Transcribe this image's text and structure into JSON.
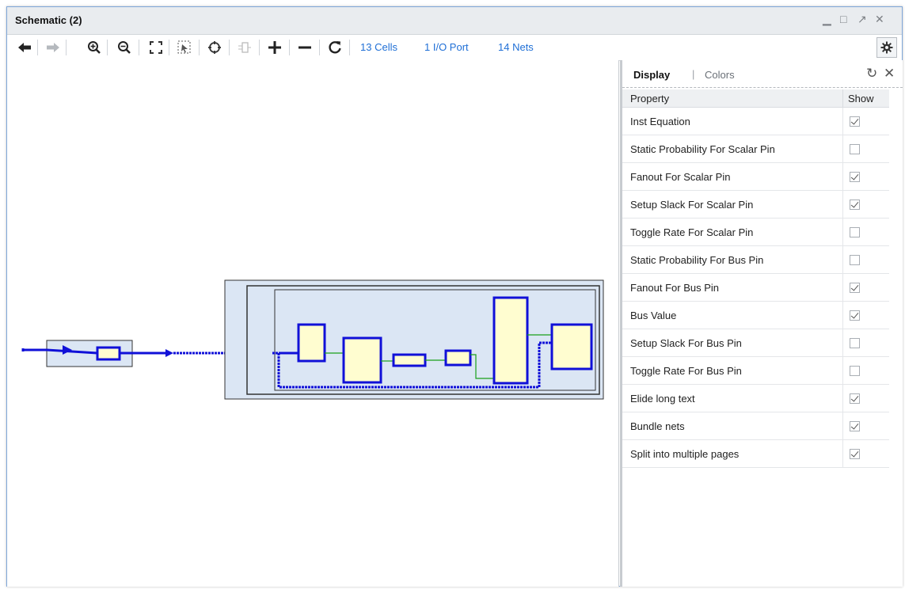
{
  "window": {
    "title": "Schematic (2)",
    "controls": [
      "minimize-icon",
      "maximize-icon",
      "restore-icon",
      "close-icon"
    ]
  },
  "toolbar": {
    "icons": [
      "back-arrow-icon",
      "forward-arrow-icon",
      "zoom-in-icon",
      "zoom-out-icon",
      "fit-view-icon",
      "zoom-select-icon",
      "find-crosshair-icon",
      "pin-icon",
      "expand-plus-icon",
      "collapse-minus-icon",
      "refresh-icon"
    ],
    "cells": "13 Cells",
    "ports": "1 I/O Port",
    "nets": "14 Nets",
    "settings_icon": "gear-icon"
  },
  "panel": {
    "tabs": {
      "display": "Display",
      "separator": "|",
      "colors": "Colors"
    },
    "columns": {
      "property": "Property",
      "show": "Show"
    },
    "rows": [
      {
        "label": "Inst Equation",
        "checked": true
      },
      {
        "label": "Static Probability For Scalar Pin",
        "checked": false
      },
      {
        "label": "Fanout For Scalar Pin",
        "checked": true
      },
      {
        "label": "Setup Slack For Scalar Pin",
        "checked": true
      },
      {
        "label": "Toggle Rate For Scalar Pin",
        "checked": false
      },
      {
        "label": "Static Probability For Bus Pin",
        "checked": false
      },
      {
        "label": "Fanout For Bus Pin",
        "checked": true
      },
      {
        "label": "Bus Value",
        "checked": true
      },
      {
        "label": "Setup Slack For Bus Pin",
        "checked": false
      },
      {
        "label": "Toggle Rate For Bus Pin",
        "checked": false
      },
      {
        "label": "Elide long text",
        "checked": true
      },
      {
        "label": "Bundle nets",
        "checked": true
      },
      {
        "label": "Split into multiple pages",
        "checked": true
      }
    ]
  },
  "colors": {
    "accent": "#1f6fd6",
    "net": "#1010d8",
    "cell_fill": "#fffdd0",
    "hier_fill": "#dbe6f4",
    "wire": "#19a019"
  }
}
